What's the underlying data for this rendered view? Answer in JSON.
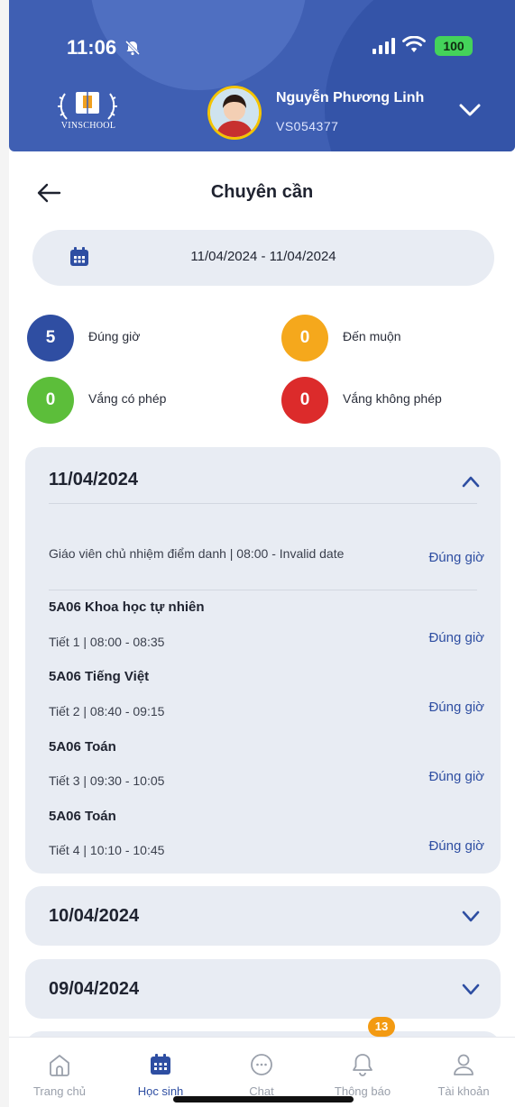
{
  "status_bar": {
    "time": "11:06",
    "battery": "100"
  },
  "header": {
    "logo_text": "VINSCHOOL",
    "student_name": "Nguyễn Phương Linh",
    "student_id": "VS054377"
  },
  "page": {
    "title": "Chuyên cần"
  },
  "date_range": {
    "value": "11/04/2024 - 11/04/2024"
  },
  "summary": [
    {
      "count": "5",
      "label": "Đúng giờ",
      "color": "#2f4ea2"
    },
    {
      "count": "0",
      "label": "Đến muộn",
      "color": "#f5a81c"
    },
    {
      "count": "0",
      "label": "Vắng có phép",
      "color": "#5cbe3a"
    },
    {
      "count": "0",
      "label": "Vắng không phép",
      "color": "#dc2b2b"
    }
  ],
  "days": [
    {
      "date": "11/04/2024",
      "expanded": true,
      "homeroom": {
        "text": "Giáo viên chủ nhiệm điểm danh | 08:00 - Invalid date",
        "status": "Đúng giờ"
      },
      "lessons": [
        {
          "subject": "5A06 Khoa học tự nhiên",
          "period": "Tiết 1 | 08:00 - 08:35",
          "status": "Đúng giờ"
        },
        {
          "subject": "5A06 Tiếng Việt",
          "period": "Tiết 2 | 08:40 - 09:15",
          "status": "Đúng giờ"
        },
        {
          "subject": "5A06 Toán",
          "period": "Tiết 3 | 09:30 - 10:05",
          "status": "Đúng giờ"
        },
        {
          "subject": "5A06 Toán",
          "period": "Tiết 4 | 10:10 - 10:45",
          "status": "Đúng giờ"
        }
      ]
    },
    {
      "date": "10/04/2024",
      "expanded": false
    },
    {
      "date": "09/04/2024",
      "expanded": false
    }
  ],
  "bottom_nav": [
    {
      "label": "Trang chủ",
      "icon": "home-icon",
      "active": false
    },
    {
      "label": "Học sinh",
      "icon": "calendar-icon",
      "active": true
    },
    {
      "label": "Chat",
      "icon": "chat-icon",
      "active": false
    },
    {
      "label": "Thông báo",
      "icon": "bell-icon",
      "active": false,
      "badge": "13"
    },
    {
      "label": "Tài khoản",
      "icon": "user-icon",
      "active": false
    }
  ],
  "colors": {
    "brand": "#3f5fb3",
    "accent": "#2e4ea2",
    "card_bg": "#e8ecf3"
  }
}
